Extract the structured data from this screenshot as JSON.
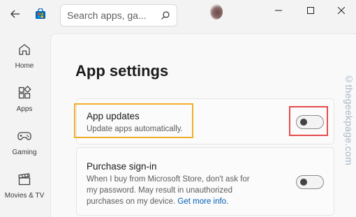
{
  "header": {
    "search_placeholder": "Search apps, ga...",
    "back_icon": "arrow-left-icon",
    "logo_icon": "microsoft-store-icon",
    "search_icon": "search-icon",
    "window_controls": [
      "minimize-icon",
      "maximize-icon",
      "close-icon"
    ]
  },
  "sidebar": {
    "items": [
      {
        "label": "Home",
        "icon": "home-icon"
      },
      {
        "label": "Apps",
        "icon": "apps-grid-icon"
      },
      {
        "label": "Gaming",
        "icon": "gamepad-icon"
      },
      {
        "label": "Movies & TV",
        "icon": "clapperboard-icon"
      }
    ]
  },
  "main": {
    "title": "App settings",
    "settings": [
      {
        "title": "App updates",
        "description": "Update apps automatically.",
        "toggle_on": false
      },
      {
        "title": "Purchase sign-in",
        "description_lines": [
          "When I buy from Microsoft Store, don't ask for",
          "my password. May result in unauthorized",
          "purchases on my device."
        ],
        "link_text": "Get more info.",
        "toggle_on": false
      }
    ]
  },
  "watermark": "©thegeekpage.com",
  "colors": {
    "highlight_orange": "#f0ad2a",
    "highlight_red": "#e54b4b",
    "link": "#005fb8",
    "logo_blue": "#0067c0"
  }
}
